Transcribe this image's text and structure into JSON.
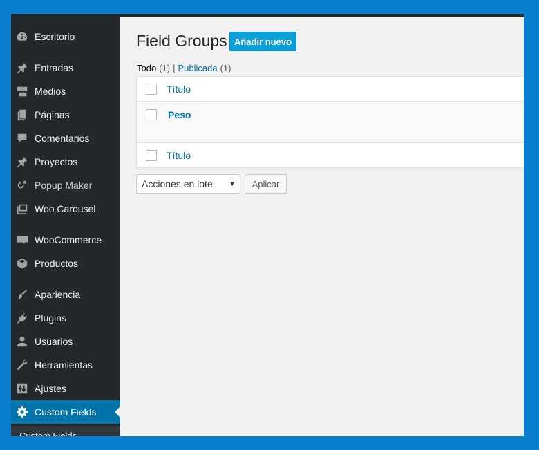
{
  "sidebar": {
    "items": [
      {
        "label": "Escritorio",
        "icon": "dashboard-icon"
      },
      {
        "label": "Entradas",
        "icon": "pushpin-icon"
      },
      {
        "label": "Medios",
        "icon": "media-icon"
      },
      {
        "label": "Páginas",
        "icon": "pages-icon"
      },
      {
        "label": "Comentarios",
        "icon": "comment-icon"
      },
      {
        "label": "Proyectos",
        "icon": "pushpin-icon"
      },
      {
        "label": "Popup Maker",
        "icon": "popup-icon"
      },
      {
        "label": "Woo Carousel",
        "icon": "carousel-icon"
      },
      {
        "label": "WooCommerce",
        "icon": "woocommerce-icon"
      },
      {
        "label": "Productos",
        "icon": "box-icon"
      },
      {
        "label": "Apariencia",
        "icon": "brush-icon"
      },
      {
        "label": "Plugins",
        "icon": "plug-icon"
      },
      {
        "label": "Usuarios",
        "icon": "user-icon"
      },
      {
        "label": "Herramientas",
        "icon": "wrench-icon"
      },
      {
        "label": "Ajustes",
        "icon": "settings-icon"
      },
      {
        "label": "Custom Fields",
        "icon": "gear-icon",
        "active": true
      }
    ],
    "submenu_first": "Custom Fields"
  },
  "main": {
    "title": "Field Groups",
    "add_new": "Añadir nuevo",
    "filters": {
      "all_label": "Todo",
      "all_count": "(1)",
      "separator": "|",
      "published_label": "Publicada",
      "published_count": "(1)"
    },
    "table": {
      "header_col": "Título",
      "rows": [
        {
          "title": "Peso"
        }
      ],
      "footer_col": "Título"
    },
    "bulk": {
      "selected": "Acciones en lote",
      "apply": "Aplicar"
    }
  },
  "colors": {
    "frame_bg": "#0a7fd0",
    "sidebar_bg": "#23282d",
    "active_bg": "#0073aa",
    "link": "#0073aa",
    "button_primary": "#0aa0d8"
  }
}
